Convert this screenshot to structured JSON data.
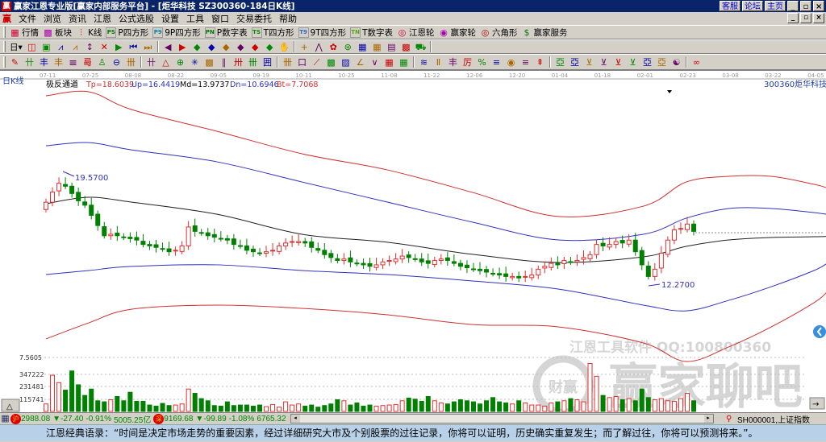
{
  "window": {
    "title": "赢家江恩专业版[赢家内部服务平台] - [炬华科技    SZ300360-184日K线]",
    "links": [
      "客服",
      "论坛",
      "主页"
    ],
    "win_buttons": [
      "_",
      "▫",
      "×"
    ]
  },
  "menu": [
    "文件",
    "浏览",
    "资讯",
    "江恩",
    "公式选股",
    "设置",
    "工具",
    "窗口",
    "交易委托",
    "帮助"
  ],
  "toolbar1": [
    {
      "icon": "quote-board-icon",
      "glyph": "▦",
      "label": "行情"
    },
    {
      "icon": "sector-icon",
      "glyph": "▩",
      "label": "板块"
    },
    {
      "icon": "kline-icon",
      "glyph": "⫶",
      "label": "K线"
    },
    {
      "icon": "p-square-icon",
      "glyph": "PS",
      "label": "P四方形"
    },
    {
      "icon": "9p-square-icon",
      "glyph": "P9",
      "label": "9P四方形"
    },
    {
      "icon": "p-number-table-icon",
      "glyph": "PN",
      "label": "P数字表"
    },
    {
      "icon": "t-square-icon",
      "glyph": "TS",
      "label": "T四方形"
    },
    {
      "icon": "9t-square-icon",
      "glyph": "T9",
      "label": "9T四方形"
    },
    {
      "icon": "t-number-table-icon",
      "glyph": "TN",
      "label": "T数字表"
    },
    {
      "icon": "gann-wheel-icon",
      "glyph": "◎",
      "label": "江恩轮"
    },
    {
      "icon": "winner-wheel-icon",
      "glyph": "◉",
      "label": "赢家轮"
    },
    {
      "icon": "hexagon-icon",
      "glyph": "◎",
      "label": "六角形"
    },
    {
      "icon": "service-icon",
      "glyph": "$",
      "label": "赢家服务"
    }
  ],
  "toolbar2": {
    "period": "日",
    "icons": [
      "◫",
      "▣",
      "⩘",
      "⩘",
      "↕",
      "✕",
      "▶",
      "⏮",
      "⏭",
      "◀",
      "▶",
      "◆",
      "◆",
      "◆",
      "◆",
      "◆",
      "◆",
      "✋",
      "+",
      "⋀",
      "✿",
      "⊛",
      "▦",
      "▦",
      "▤",
      "▩",
      "⛟"
    ]
  },
  "toolbar3": {
    "icons": [
      "✎",
      "卄",
      "丰",
      "丰",
      "𝍣",
      "㢴",
      "♙",
      "⊖",
      "卌",
      "卄",
      "△",
      "⊕",
      "✳",
      "▩",
      "∥",
      "卅",
      "卌",
      "囲",
      "卌",
      "口",
      "⟋",
      "▩",
      "▨",
      "∠",
      "∨",
      "▦",
      "▦",
      "≋",
      "Ⅱ",
      "丰",
      "厉",
      "%",
      "≡",
      "◉",
      "≡",
      "⇞",
      "亞",
      "亞",
      "⊻",
      "⊻",
      "⊻",
      "⊻",
      "亞",
      "亞",
      "☯",
      "∞"
    ]
  },
  "chart": {
    "period_label": "日K线",
    "indicator_name": "极反通道",
    "indicators": [
      {
        "text": "Tp=18.6039",
        "color": "#d03030"
      },
      {
        "text": "Up=16.4419",
        "color": "#3030c0"
      },
      {
        "text": "Md=13.9737",
        "color": "#000000"
      },
      {
        "text": "Dn=10.6946",
        "color": "#3030c0"
      },
      {
        "text": "Bt=7.7068",
        "color": "#d03030"
      }
    ],
    "stock_code": "300360",
    "stock_name": "炬华科技",
    "high_label": "19.5700",
    "low_label": "12.2700",
    "watermark_line": "江恩工具软件  QQ:100800360",
    "watermark_big": "赢家聊吧",
    "watermark_logo": "财赢",
    "watermark_url": "jiaoba.yingjia"
  },
  "chart_data": {
    "type": "candlestick",
    "x_ticks": [
      "07-11",
      "07-25",
      "08-08",
      "08-22",
      "09-05",
      "09-19",
      "10-11",
      "10-25",
      "11-08",
      "11-22",
      "12-06",
      "12-20",
      "01-04",
      "01-18",
      "02-01",
      "02-23",
      "03-08",
      "03-22",
      "04-05"
    ],
    "closes": [
      17.9,
      18.6,
      19.2,
      19.0,
      18.5,
      18.0,
      17.7,
      17.0,
      16.3,
      15.6,
      15.7,
      15.6,
      15.5,
      15.4,
      15.3,
      15.0,
      14.9,
      14.8,
      14.7,
      14.5,
      14.6,
      14.9,
      16.2,
      15.9,
      15.8,
      15.6,
      15.5,
      15.4,
      15.3,
      15.0,
      14.9,
      14.6,
      14.5,
      14.4,
      14.5,
      14.6,
      14.9,
      15.1,
      15.2,
      15.2,
      15.1,
      14.8,
      14.6,
      14.3,
      14.1,
      13.9,
      14.0,
      13.8,
      13.7,
      13.6,
      13.5,
      13.6,
      13.8,
      13.9,
      14.0,
      14.2,
      14.1,
      14.0,
      13.8,
      13.7,
      13.9,
      14.0,
      13.9,
      13.7,
      13.5,
      13.4,
      13.3,
      13.2,
      13.1,
      13.0,
      12.9,
      12.8,
      12.8,
      12.7,
      12.8,
      12.9,
      13.3,
      13.5,
      13.7,
      13.6,
      13.9,
      13.8,
      13.9,
      14.1,
      14.3,
      15.0,
      14.9,
      15.0,
      15.2,
      15.1,
      15.3,
      14.5,
      13.6,
      12.8,
      13.3,
      14.4,
      15.3,
      16.0,
      16.1,
      16.4,
      15.9
    ],
    "volumes": [
      70000,
      340000,
      270000,
      200000,
      380000,
      250000,
      150000,
      210000,
      100000,
      90000,
      110000,
      140000,
      100000,
      180000,
      95000,
      95000,
      60000,
      50000,
      75000,
      55000,
      60000,
      70000,
      210000,
      170000,
      120000,
      100000,
      55000,
      50000,
      90000,
      55000,
      60000,
      60000,
      50000,
      60000,
      45000,
      65000,
      40000,
      90000,
      60000,
      70000,
      50000,
      60000,
      40000,
      55000,
      70000,
      110000,
      100000,
      60000,
      80000,
      50000,
      60000,
      50000,
      55000,
      60000,
      65000,
      100000,
      125000,
      115000,
      95000,
      140000,
      100000,
      80000,
      70000,
      90000,
      110000,
      100000,
      90000,
      70000,
      100000,
      130000,
      90000,
      80000,
      70000,
      100000,
      80000,
      60000,
      60000,
      50000,
      80000,
      90000,
      100000,
      120000,
      110000,
      90000,
      450000,
      330000,
      150000,
      130000,
      140000,
      110000,
      120000,
      100000,
      210000,
      130000,
      110000,
      120000,
      100000,
      95000,
      120000,
      170000,
      100000
    ],
    "volume_ticks": [
      "7.5605",
      "347222",
      "231481",
      "115741"
    ],
    "bands": {
      "dates": [
        "07-11",
        "07-25",
        "08-08",
        "09-05",
        "10-11",
        "11-08",
        "12-06",
        "01-04",
        "02-01",
        "02-23",
        "03-08",
        "03-22",
        "04-05"
      ],
      "Tp": [
        25.21,
        25.49,
        24.27,
        22.78,
        21.23,
        20.12,
        18.57,
        16.92,
        17.63,
        19.29,
        19.68,
        19.68,
        19.13
      ],
      "Up": [
        21.78,
        22.0,
        21.5,
        20.68,
        19.29,
        17.91,
        16.53,
        15.31,
        15.7,
        16.8,
        17.47,
        17.47,
        17.19
      ],
      "Md": [
        17.8,
        18.24,
        17.91,
        17.08,
        15.7,
        15.15,
        14.32,
        13.76,
        14.15,
        14.87,
        15.31,
        15.48,
        15.53
      ],
      "Dn": [
        12.93,
        13.21,
        13.49,
        13.6,
        13.21,
        12.93,
        12.49,
        11.94,
        10.83,
        10.44,
        11.16,
        12.1,
        13.21
      ],
      "Bt": [
        8.51,
        9.61,
        10.55,
        10.83,
        10.61,
        10.17,
        9.5,
        9.34,
        8.23,
        6.96,
        7.96,
        9.34,
        11.0
      ]
    },
    "colors": {
      "up": "#e03030",
      "down": "#008000",
      "Tp": "#d03030",
      "Up": "#3030c0",
      "Md": "#202020",
      "Dn": "#3030c0",
      "Bt": "#d03030"
    }
  },
  "status": {
    "sh_index": "2988.08",
    "sh_change": "▼-27.40",
    "sh_pct": "-0.91%",
    "sh_amount": "5005.25亿",
    "sz_index": "9169.68",
    "sz_change": "▼-99.89",
    "sz_pct": "-1.08%",
    "sz_amount": "6765.32",
    "current": "SH000001,上证指数",
    "hu": "沪",
    "shen": "深"
  },
  "quote": "江恩经典语录：“时间是决定市场走势的重要因素，经过详细研究大市及个别股票的过往记录，你将可以证明，历史确实重复发生；而了解过往，你将可以预测将来。”。"
}
